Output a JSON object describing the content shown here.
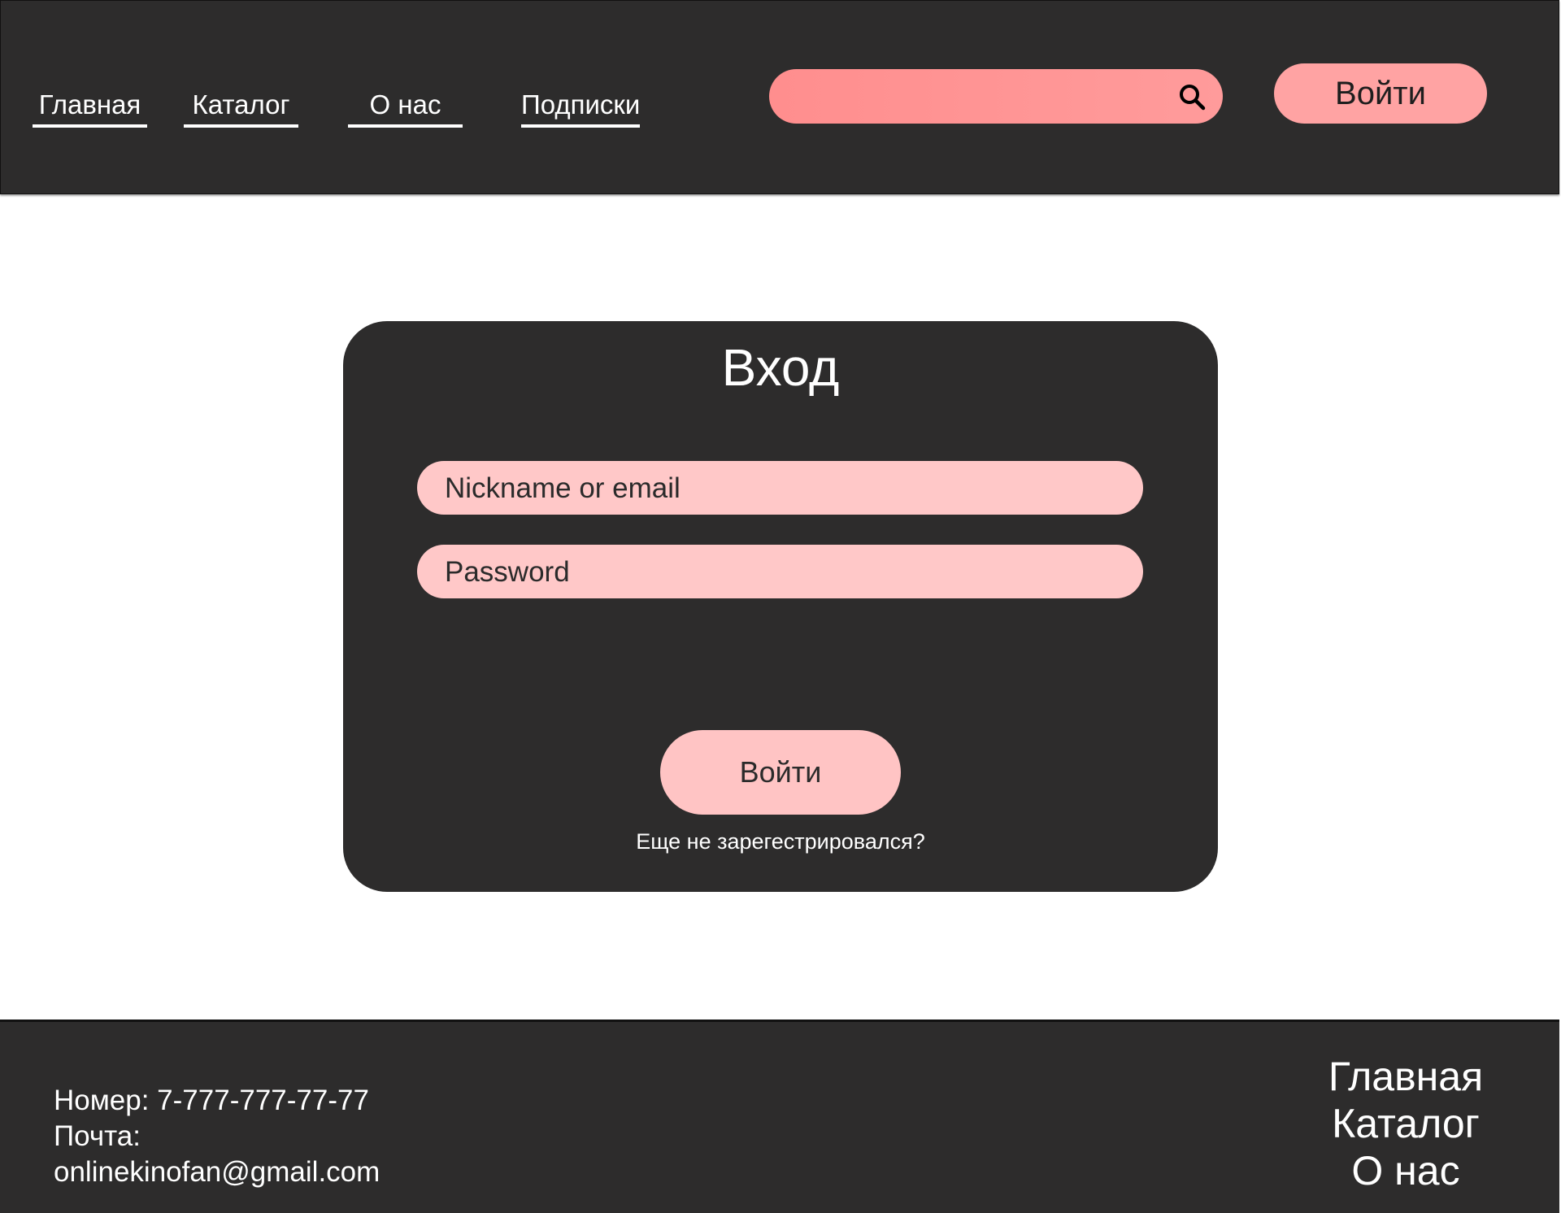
{
  "header": {
    "nav": [
      {
        "label": "Главная"
      },
      {
        "label": "Каталог"
      },
      {
        "label": "О нас"
      },
      {
        "label": "Подписки"
      }
    ],
    "search": {
      "placeholder": "",
      "icon": "search-icon"
    },
    "login_label": "Войти"
  },
  "login_card": {
    "title": "Вход",
    "username_placeholder": "Nickname or email",
    "password_placeholder": "Password",
    "submit_label": "Войти",
    "register_link": "Еще не зарегестрировался?"
  },
  "footer": {
    "phone": "Номер: 7-777-777-77-77",
    "mail_label": "Почта:",
    "mail": "onlinekinofan@gmail.com",
    "nav": [
      {
        "label": "Главная"
      },
      {
        "label": "Каталог"
      },
      {
        "label": "О нас"
      }
    ]
  },
  "colors": {
    "dark_background": "#2d2c2c",
    "accent_pink": "#ffa3a3",
    "search_pink": "#ff8e8e",
    "input_pink": "#ffc8c8"
  }
}
